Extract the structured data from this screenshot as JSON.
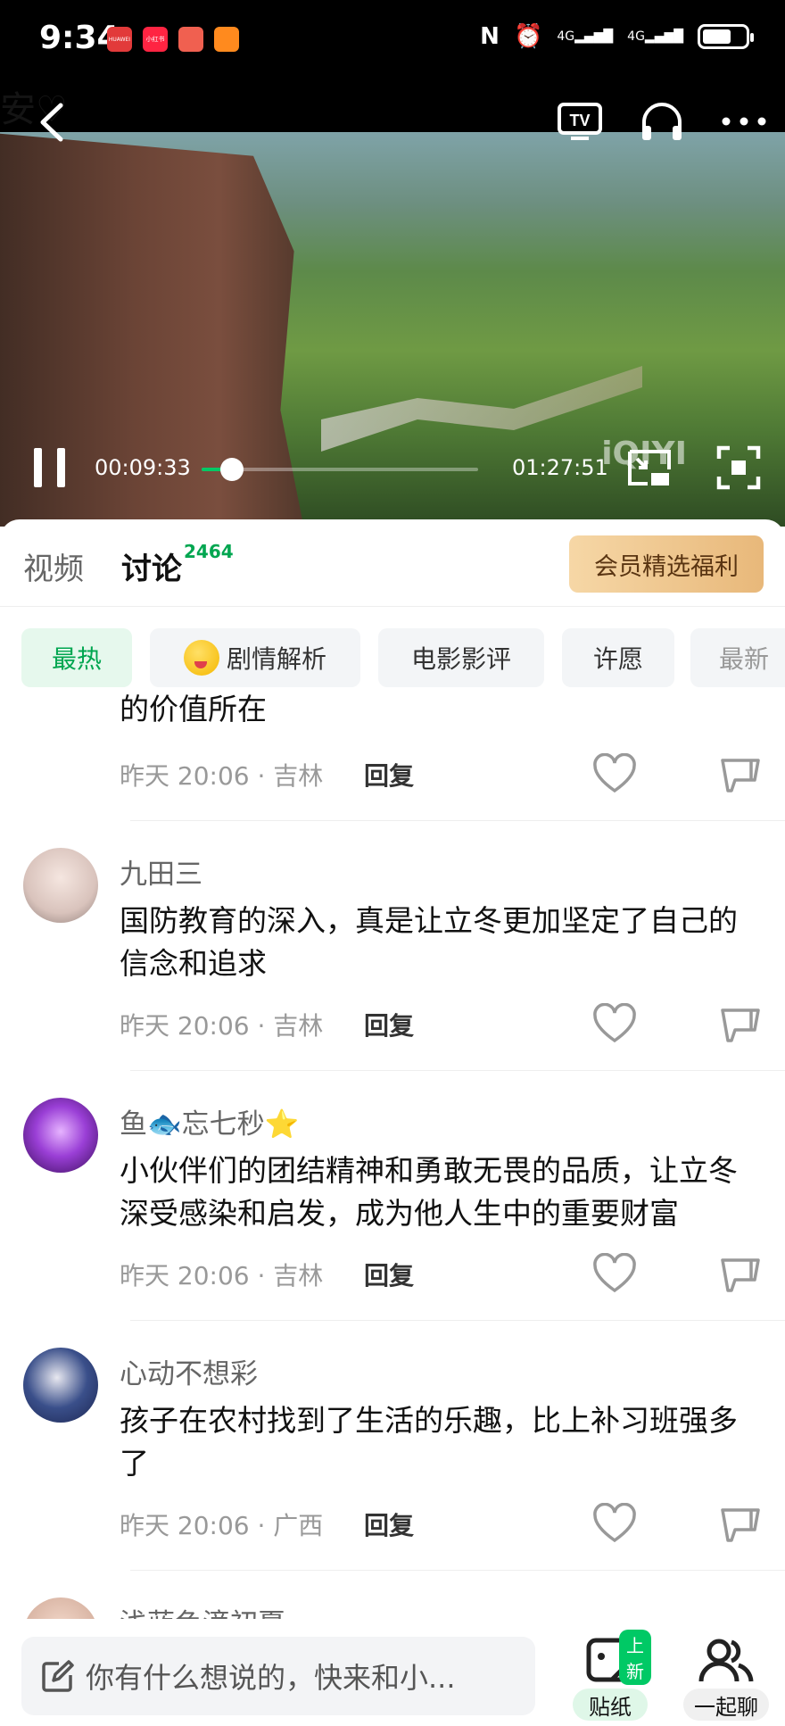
{
  "status_bar": {
    "time": "9:34",
    "apps": [
      "HUAWEI",
      "小红书",
      "app3",
      "app4"
    ],
    "network_1": "4G",
    "network_2": "4G"
  },
  "player": {
    "ghost_title": "安♡",
    "watermark": "iQIYI",
    "current_time": "00:09:33",
    "duration": "01:27:51",
    "progress_fraction": 0.11
  },
  "tabs": {
    "video_label": "视频",
    "discuss_label": "讨论",
    "discuss_count": "2464",
    "vip_label": "会员精选福利"
  },
  "chips": [
    {
      "label": "最热",
      "active": true
    },
    {
      "label": "剧情解析",
      "active": false,
      "has_emoji": true
    },
    {
      "label": "电影影评",
      "active": false
    },
    {
      "label": "许愿",
      "active": false
    },
    {
      "label": "最新",
      "active": false
    }
  ],
  "comments": {
    "partial": {
      "text_tail": "的价值所在",
      "meta": "昨天 20:06 · 吉林",
      "reply": "回复"
    },
    "items": [
      {
        "username": "九田三",
        "text": "国防教育的深入，真是让立冬更加坚定了自己的信念和追求",
        "meta": "昨天 20:06 · 吉林",
        "reply": "回复"
      },
      {
        "username": "鱼🐟忘七秒⭐",
        "text": "小伙伴们的团结精神和勇敢无畏的品质，让立冬深受感染和启发，成为他人生中的重要财富",
        "meta": "昨天 20:06 · 吉林",
        "reply": "回复"
      },
      {
        "username": "心动不想彩",
        "text": "孩子在农村找到了生活的乐趣，比上补习班强多了",
        "meta": "昨天 20:06 · 广西",
        "reply": "回复"
      },
      {
        "username": "浅蓝色滴初夏"
      }
    ]
  },
  "bottom_bar": {
    "input_placeholder": "你有什么想说的，快来和小...",
    "sticker_label": "贴纸",
    "sticker_badge": "上新",
    "together_label": "一起聊"
  },
  "colors": {
    "accent_green": "#00c965",
    "vip_gold": "#e8b87a"
  }
}
